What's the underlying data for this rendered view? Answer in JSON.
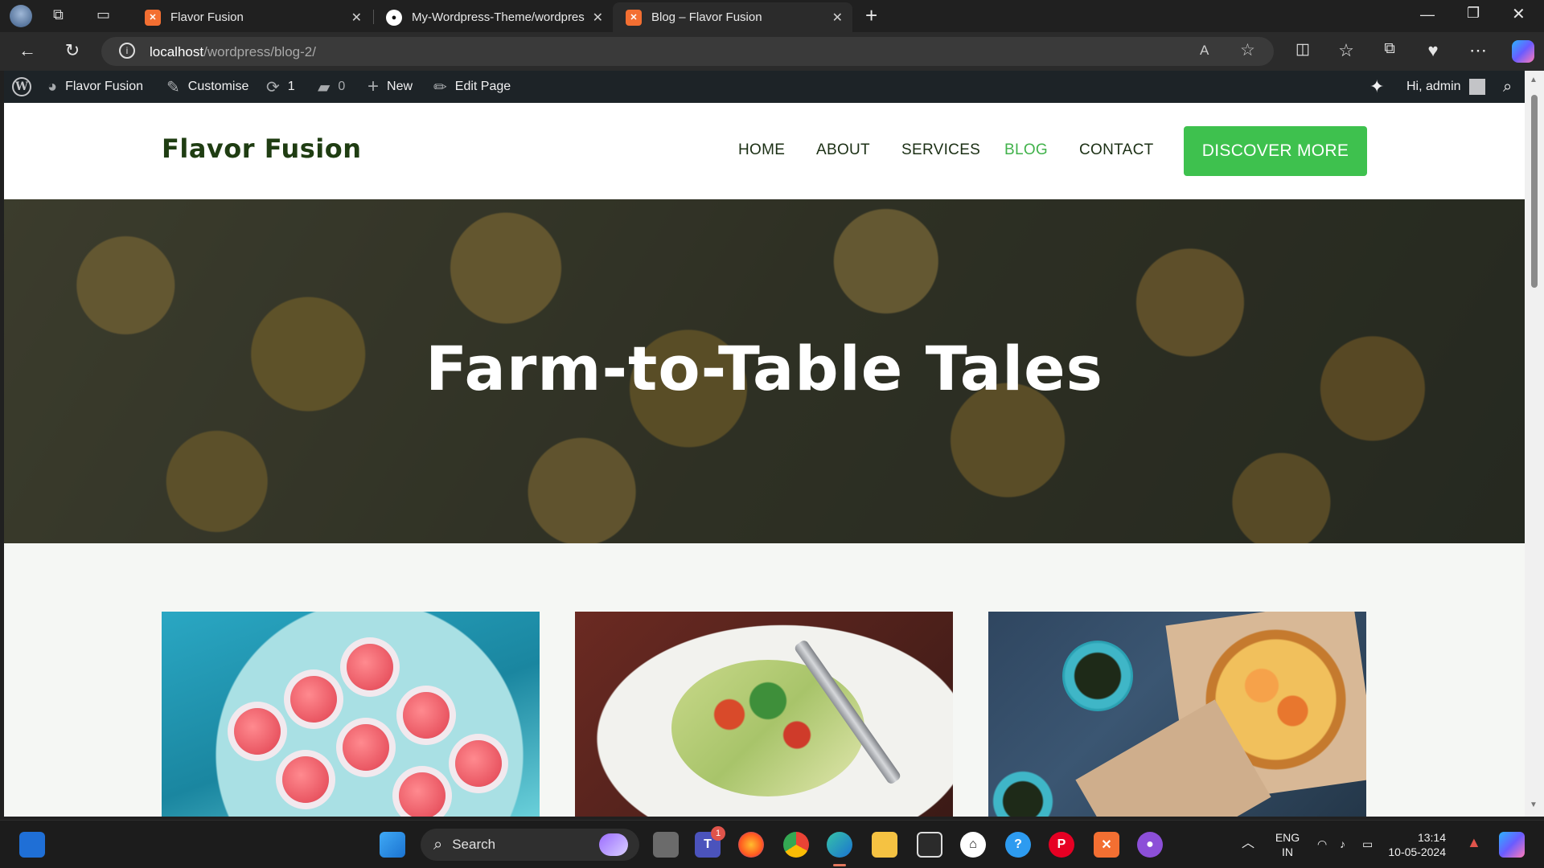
{
  "browser": {
    "tabs": [
      {
        "title": "Flavor Fusion",
        "favicon": "xampp-icon",
        "active": false
      },
      {
        "title": "My-Wordpress-Theme/wordpres",
        "favicon": "github-icon",
        "active": false
      },
      {
        "title": "Blog – Flavor Fusion",
        "favicon": "xampp-icon",
        "active": true
      }
    ],
    "new_tab": "+",
    "url_host": "localhost",
    "url_path": "/wordpress/blog-2/"
  },
  "wp_admin_bar": {
    "site_name": "Flavor Fusion",
    "customise": "Customise",
    "updates_count": "1",
    "comments_count": "0",
    "new_label": "New",
    "edit_page": "Edit Page",
    "greeting": "Hi, admin"
  },
  "site": {
    "logo": "Flavor Fusion",
    "nav": [
      "HOME",
      "ABOUT",
      "SERVICES",
      "BLOG",
      "CONTACT"
    ],
    "current_nav": "BLOG",
    "cta": "DISCOVER MORE",
    "hero_title": "Farm-to-Table Tales"
  },
  "colors": {
    "accent_green": "#3ec14e",
    "logo_green": "#1f3d12",
    "admin_bar": "#1d2327"
  },
  "taskbar": {
    "search_label": "Search",
    "language": "ENG",
    "region": "IN",
    "time": "13:14",
    "date": "10-05-2024",
    "teams_badge": "1"
  }
}
